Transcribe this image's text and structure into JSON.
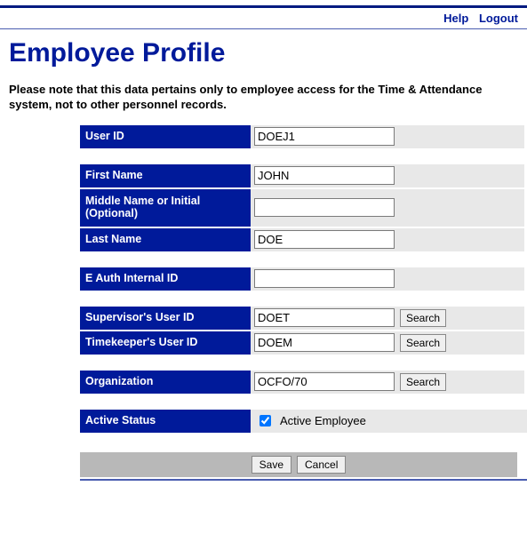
{
  "nav": {
    "help": "Help",
    "logout": "Logout"
  },
  "title": "Employee Profile",
  "note": "Please note that this data pertains only to employee access for the Time & Attendance system, not to other personnel records.",
  "labels": {
    "user_id": "User ID",
    "first_name": "First Name",
    "middle_name": "Middle Name or Initial (Optional)",
    "last_name": "Last Name",
    "eauth_id": "E Auth Internal ID",
    "supervisor_id": "Supervisor's User ID",
    "timekeeper_id": "Timekeeper's User ID",
    "organization": "Organization",
    "active_status": "Active Status",
    "active_employee": "Active Employee",
    "search": "Search",
    "save": "Save",
    "cancel": "Cancel"
  },
  "values": {
    "user_id": "DOEJ1",
    "first_name": "JOHN",
    "middle_name": "",
    "last_name": "DOE",
    "eauth_id": "",
    "supervisor_id": "DOET",
    "timekeeper_id": "DOEM",
    "organization": "OCFO/70",
    "active_checked": true
  }
}
